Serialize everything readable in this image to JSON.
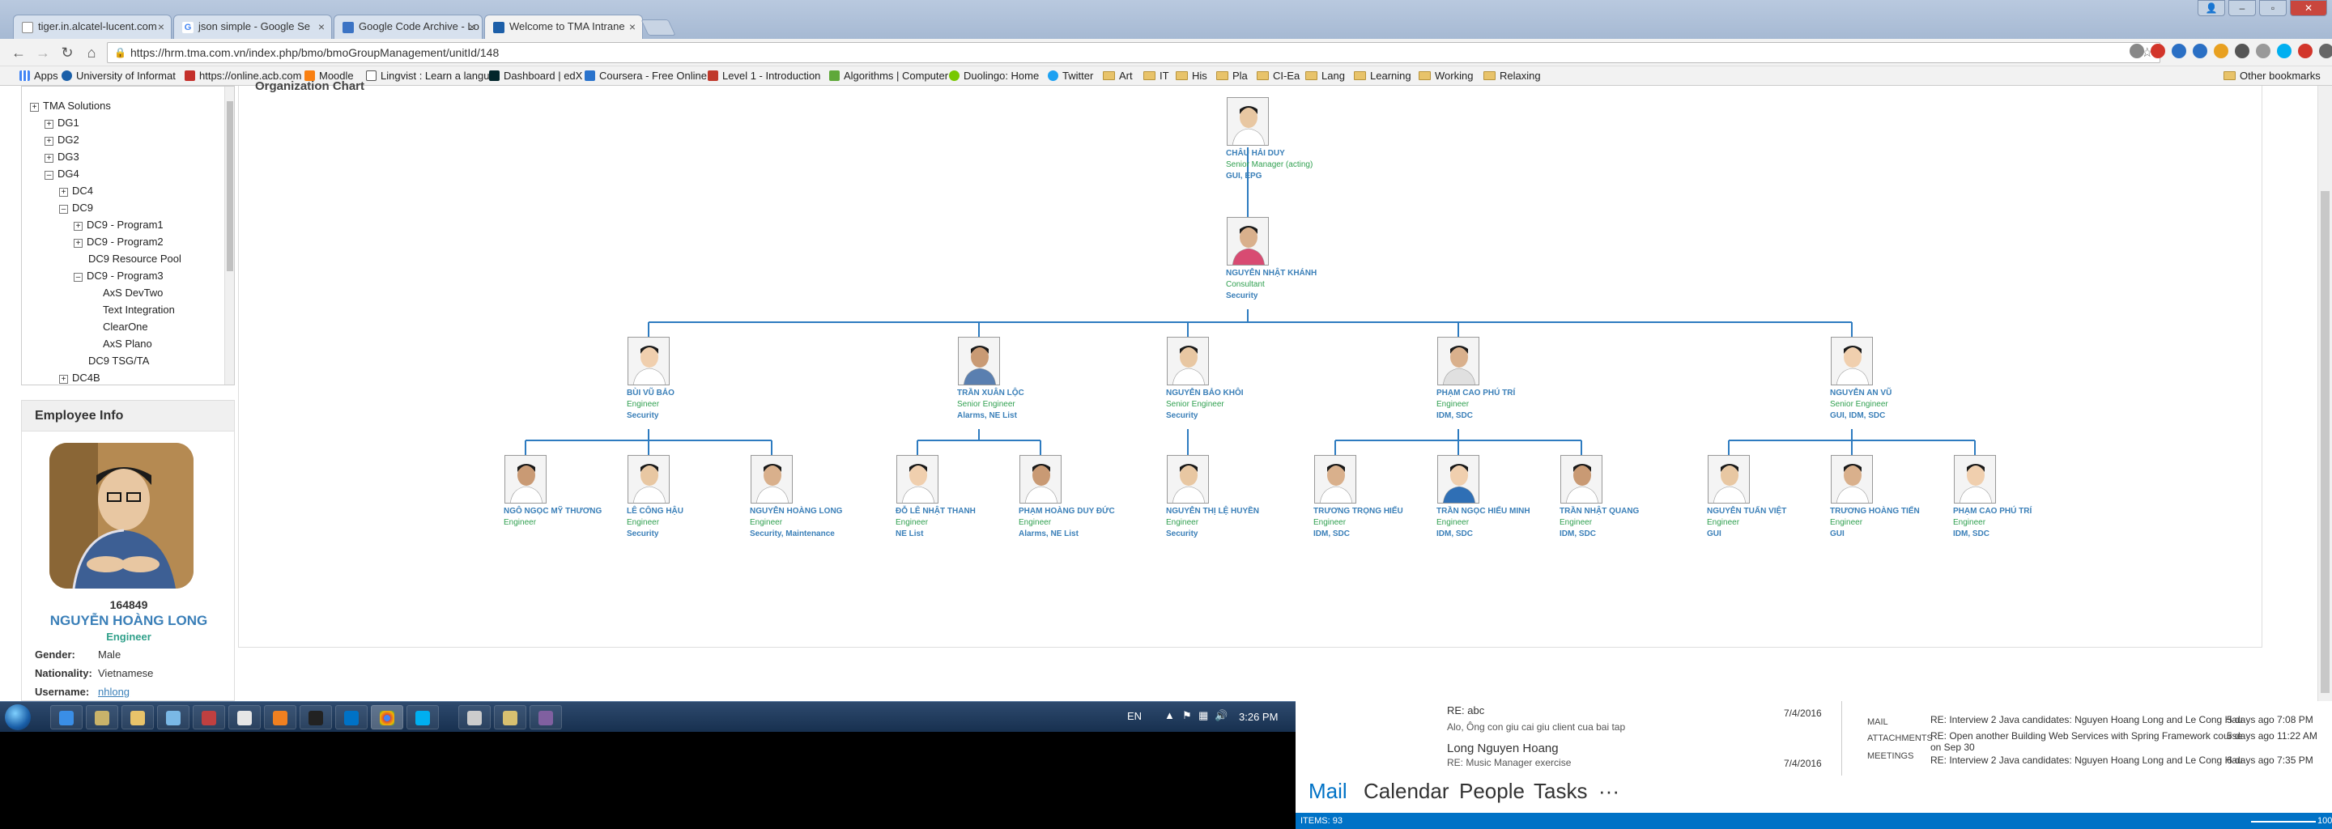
{
  "browser": {
    "tabs": [
      {
        "title": "tiger.in.alcatel-lucent.com"
      },
      {
        "title": "json simple - Google Se"
      },
      {
        "title": "Google Code Archive - Lo"
      },
      {
        "title": "Welcome to TMA Intrane"
      }
    ],
    "url": "https://hrm.tma.com.vn/index.php/bmo/bmoGroupManagement/unitId/148",
    "bookmarks": [
      "Apps",
      "University of Informat",
      "https://online.acb.com",
      "Moodle",
      "Lingvist : Learn a langu",
      "Dashboard | edX",
      "Coursera - Free Online",
      "Level 1 - Introduction",
      "Algorithms | Computer",
      "Duolingo: Home",
      "Twitter",
      "Art",
      "IT",
      "His",
      "Pla",
      "CI-Ea",
      "Lang",
      "Learning",
      "Working",
      "Relaxing"
    ],
    "other_bookmarks": "Other bookmarks"
  },
  "tree": {
    "root": "TMA Solutions",
    "items": [
      "DG1",
      "DG2",
      "DG3",
      "DG4",
      "DC4",
      "DC9",
      "DC9 - Program1",
      "DC9 - Program2",
      "DC9 Resource Pool",
      "DC9 - Program3",
      "AxS DevTwo",
      "Text Integration",
      "ClearOne",
      "AxS Plano",
      "DC9 TSG/TA",
      "DC4B"
    ]
  },
  "employee": {
    "header": "Employee Info",
    "id": "164849",
    "name": "NGUYỄN HOÀNG LONG",
    "title": "Engineer",
    "gender_label": "Gender:",
    "gender": "Male",
    "nationality_label": "Nationality:",
    "nationality": "Vietnamese",
    "username_label": "Username:",
    "username": "nhlong"
  },
  "org": {
    "header": "Organization Chart",
    "people": [
      {
        "name": "CHÂU HẢI DUY",
        "role": "Senior Manager (acting)",
        "team": "GUI, EPG"
      },
      {
        "name": "NGUYỄN NHẬT KHÁNH",
        "role": "Consultant",
        "team": "Security"
      },
      {
        "name": "BÙI VŨ BẢO",
        "role": "Engineer",
        "team": "Security"
      },
      {
        "name": "TRẦN XUÂN LỘC",
        "role": "Senior Engineer",
        "team": "Alarms, NE List"
      },
      {
        "name": "NGUYỄN BẢO KHÔI",
        "role": "Senior Engineer",
        "team": "Security"
      },
      {
        "name": "PHẠM CAO PHÚ TRÍ",
        "role": "Engineer",
        "team": "IDM, SDC"
      },
      {
        "name": "NGUYỄN AN VŨ",
        "role": "Senior Engineer",
        "team": "GUI, IDM, SDC"
      },
      {
        "name": "NGÔ NGỌC MỸ THƯƠNG",
        "role": "Engineer",
        "team": ""
      },
      {
        "name": "LÊ CÔNG HẬU",
        "role": "Engineer",
        "team": "Security"
      },
      {
        "name": "NGUYỄN HOÀNG LONG",
        "role": "Engineer",
        "team": "Security, Maintenance"
      },
      {
        "name": "ĐỖ LÊ NHẬT THANH",
        "role": "Engineer",
        "team": "NE List"
      },
      {
        "name": "PHẠM HOÀNG DUY ĐỨC",
        "role": "Engineer",
        "team": "Alarms, NE List"
      },
      {
        "name": "NGUYỄN THỊ LỆ HUYỀN",
        "role": "Engineer",
        "team": "Security"
      },
      {
        "name": "TRƯƠNG TRỌNG HIẾU",
        "role": "Engineer",
        "team": "IDM, SDC"
      },
      {
        "name": "TRẦN NGỌC HIẾU MINH",
        "role": "Engineer",
        "team": "IDM, SDC"
      },
      {
        "name": "TRẦN NHẬT QUANG",
        "role": "Engineer",
        "team": "IDM, SDC"
      },
      {
        "name": "NGUYỄN TUẤN VIỆT",
        "role": "Engineer",
        "team": "GUI"
      },
      {
        "name": "TRƯƠNG HOÀNG TIẾN",
        "role": "Engineer",
        "team": "GUI"
      },
      {
        "name": "PHẠM CAO PHÚ TRÍ",
        "role": "Engineer",
        "team": "IDM, SDC"
      }
    ]
  },
  "taskbar": {
    "lang": "EN",
    "time": "3:26 PM"
  },
  "outlook": {
    "mail_items": [
      {
        "from": "RE: abc",
        "preview": "Alo, Ông con giu cai giu client cua bai tap",
        "date": "7/4/2016"
      },
      {
        "from": "Long Nguyen Hoang",
        "preview": "RE: Music Manager exercise",
        "date": "7/4/2016"
      }
    ],
    "categories": [
      "MAIL",
      "ATTACHMENTS",
      "MEETINGS"
    ],
    "related": [
      {
        "subject": "RE: Interview 2 Java candidates: Nguyen Hoang Long and Le Cong Hau",
        "date": "5 days ago 7:08 PM"
      },
      {
        "subject": "RE: Open another Building Web Services with Spring Framework course",
        "date": "5 days ago 11:22 AM"
      },
      {
        "subject": "on Sep 30",
        "date": ""
      },
      {
        "subject": "RE: Interview 2 Java candidates: Nguyen Hoang Long and Le Cong Hau",
        "date": "6 days ago 7:35 PM"
      }
    ],
    "nav": [
      "Mail",
      "Calendar",
      "People",
      "Tasks",
      "···"
    ],
    "status_items": "ITEMS: 93",
    "zoom": "100%"
  },
  "colors": {
    "link_blue": "#3a7fb8",
    "role_green": "#30a050",
    "line_blue": "#2d7bc0"
  }
}
